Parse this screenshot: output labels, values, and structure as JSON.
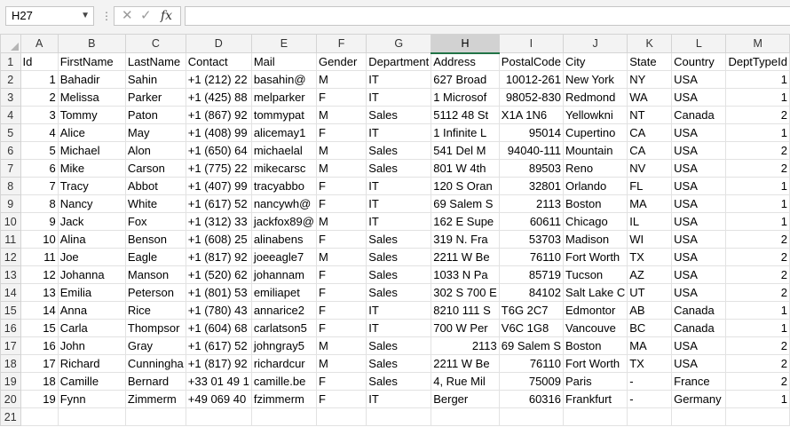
{
  "namebox": {
    "value": "H27"
  },
  "formula_bar": {
    "value": "",
    "separator": "⋮",
    "cancel_glyph": "✕",
    "enter_glyph": "✓",
    "fx_glyph": "fx"
  },
  "columns": [
    "A",
    "B",
    "C",
    "D",
    "E",
    "F",
    "G",
    "H",
    "I",
    "J",
    "K",
    "L",
    "M"
  ],
  "selected_column": "H",
  "rows": [
    {
      "num": "1",
      "cells": [
        "Id",
        "FirstName",
        "LastName",
        "Contact",
        "Mail",
        "Gender",
        "Department",
        "Address",
        "PostalCode",
        "City",
        "State",
        "Country",
        "DeptTypeId"
      ]
    },
    {
      "num": "2",
      "cells": [
        "1",
        "Bahadir",
        "Sahin",
        "+1 (212) 22",
        "basahin@",
        "M",
        "IT",
        "627 Broad",
        "10012-261",
        "New York",
        "NY",
        "USA",
        "1"
      ]
    },
    {
      "num": "3",
      "cells": [
        "2",
        "Melissa",
        "Parker",
        "+1 (425) 88",
        "melparker",
        "F",
        "IT",
        "1 Microsof",
        "98052-830",
        "Redmond",
        "WA",
        "USA",
        "1"
      ]
    },
    {
      "num": "4",
      "cells": [
        "3",
        "Tommy",
        "Paton",
        "+1 (867) 92",
        "tommypat",
        "M",
        "Sales",
        "5112 48 St",
        "X1A 1N6",
        "Yellowkni",
        "NT",
        "Canada",
        "2"
      ]
    },
    {
      "num": "5",
      "cells": [
        "4",
        "Alice",
        "May",
        "+1 (408) 99",
        "alicemay1",
        "F",
        "IT",
        "1 Infinite L",
        "95014",
        "Cupertino",
        "CA",
        "USA",
        "1"
      ]
    },
    {
      "num": "6",
      "cells": [
        "5",
        "Michael",
        "Alon",
        "+1 (650) 64",
        "michaelal",
        "M",
        "Sales",
        "541 Del M",
        "94040-111",
        "Mountain",
        "CA",
        "USA",
        "2"
      ]
    },
    {
      "num": "7",
      "cells": [
        "6",
        "Mike",
        "Carson",
        "+1 (775) 22",
        "mikecarsc",
        "M",
        "Sales",
        "801 W 4th",
        "89503",
        "Reno",
        "NV",
        "USA",
        "2"
      ]
    },
    {
      "num": "8",
      "cells": [
        "7",
        "Tracy",
        "Abbot",
        "+1 (407) 99",
        "tracyabbo",
        "F",
        "IT",
        "120 S Oran",
        "32801",
        "Orlando",
        "FL",
        "USA",
        "1"
      ]
    },
    {
      "num": "9",
      "cells": [
        "8",
        "Nancy",
        "White",
        "+1 (617) 52",
        "nancywh@",
        "F",
        "IT",
        "69 Salem S",
        "2113",
        "Boston",
        "MA",
        "USA",
        "1"
      ]
    },
    {
      "num": "10",
      "cells": [
        "9",
        "Jack",
        "Fox",
        "+1 (312) 33",
        "jackfox89@",
        "M",
        "IT",
        "162 E Supe",
        "60611",
        "Chicago",
        "IL",
        "USA",
        "1"
      ]
    },
    {
      "num": "11",
      "cells": [
        "10",
        "Alina",
        "Benson",
        "+1 (608) 25",
        "alinabens",
        "F",
        "Sales",
        "319 N. Fra",
        "53703",
        "Madison",
        "WI",
        "USA",
        "2"
      ]
    },
    {
      "num": "12",
      "cells": [
        "11",
        "Joe",
        "Eagle",
        "+1 (817) 92",
        "joeeagle7",
        "M",
        "Sales",
        "2211 W Be",
        "76110",
        "Fort Worth",
        "TX",
        "USA",
        "2"
      ]
    },
    {
      "num": "13",
      "cells": [
        "12",
        "Johanna",
        "Manson",
        "+1 (520) 62",
        "johannam",
        "F",
        "Sales",
        "1033 N Pa",
        "85719",
        "Tucson",
        "AZ",
        "USA",
        "2"
      ]
    },
    {
      "num": "14",
      "cells": [
        "13",
        "Emilia",
        "Peterson",
        "+1 (801) 53",
        "emiliapet",
        "F",
        "Sales",
        "302 S 700 E",
        "84102",
        "Salt Lake C",
        "UT",
        "USA",
        "2"
      ]
    },
    {
      "num": "15",
      "cells": [
        "14",
        "Anna",
        "Rice",
        "+1 (780) 43",
        "annarice2",
        "F",
        "IT",
        "8210 111 S",
        "T6G 2C7",
        "Edmontor",
        "AB",
        "Canada",
        "1"
      ]
    },
    {
      "num": "16",
      "cells": [
        "15",
        "Carla",
        "Thompsor",
        "+1 (604) 68",
        "carlatson5",
        "F",
        "IT",
        "700 W Per",
        "V6C 1G8",
        "Vancouve",
        "BC",
        "Canada",
        "1"
      ]
    },
    {
      "num": "17",
      "cells": [
        "16",
        "John",
        "Gray",
        "+1 (617) 52",
        "johngray5",
        "M",
        "Sales",
        "2113",
        "69 Salem S",
        "Boston",
        "MA",
        "USA",
        "2"
      ]
    },
    {
      "num": "18",
      "cells": [
        "17",
        "Richard",
        "Cunningha",
        "+1 (817) 92",
        "richardcur",
        "M",
        "Sales",
        "2211 W Be",
        "76110",
        "Fort Worth",
        "TX",
        "USA",
        "2"
      ]
    },
    {
      "num": "19",
      "cells": [
        "18",
        "Camille",
        "Bernard",
        "+33 01 49 1",
        "camille.be",
        "F",
        "Sales",
        "4, Rue Mil",
        "75009",
        "Paris",
        "-",
        "France",
        "2"
      ]
    },
    {
      "num": "20",
      "cells": [
        "19",
        "Fynn",
        "Zimmerm",
        "+49 069 40",
        "fzimmerm",
        "F",
        "IT",
        "Berger",
        "60316",
        "Frankfurt",
        "-",
        "Germany",
        "1"
      ]
    },
    {
      "num": "21",
      "cells": [
        "",
        "",
        "",
        "",
        "",
        "",
        "",
        "",
        "",
        "",
        "",
        "",
        ""
      ]
    }
  ]
}
